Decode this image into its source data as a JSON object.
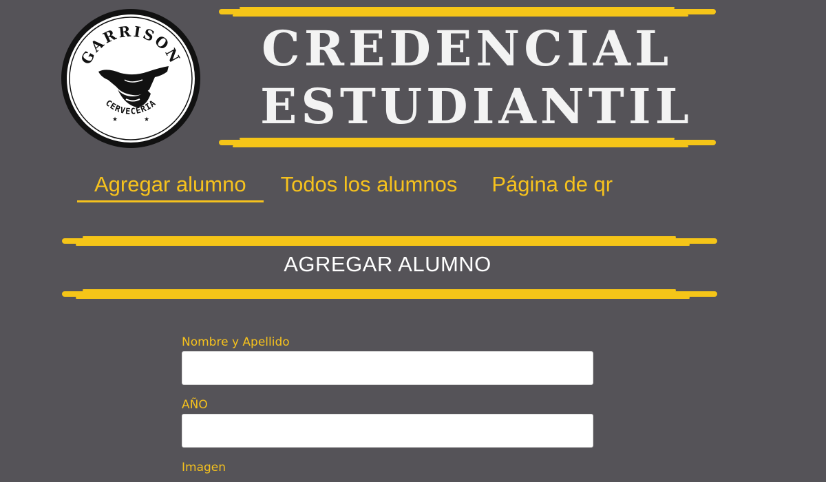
{
  "brand": {
    "logo_top_text": "GARRISON",
    "logo_bottom_text": "CERVECERIA",
    "accent_color": "#f6c21d",
    "background_color": "#555358"
  },
  "header": {
    "title_line1": "CREDENCIAL",
    "title_line2": "ESTUDIANTIL"
  },
  "nav": {
    "items": [
      {
        "label": "Agregar alumno",
        "active": true
      },
      {
        "label": "Todos los alumnos",
        "active": false
      },
      {
        "label": "Página de qr",
        "active": false
      }
    ]
  },
  "section": {
    "title": "AGREGAR ALUMNO"
  },
  "form": {
    "fields": [
      {
        "label": "Nombre y Apellido",
        "value": "",
        "placeholder": ""
      },
      {
        "label": "AÑO",
        "value": "",
        "placeholder": ""
      },
      {
        "label": "Imagen"
      }
    ]
  }
}
